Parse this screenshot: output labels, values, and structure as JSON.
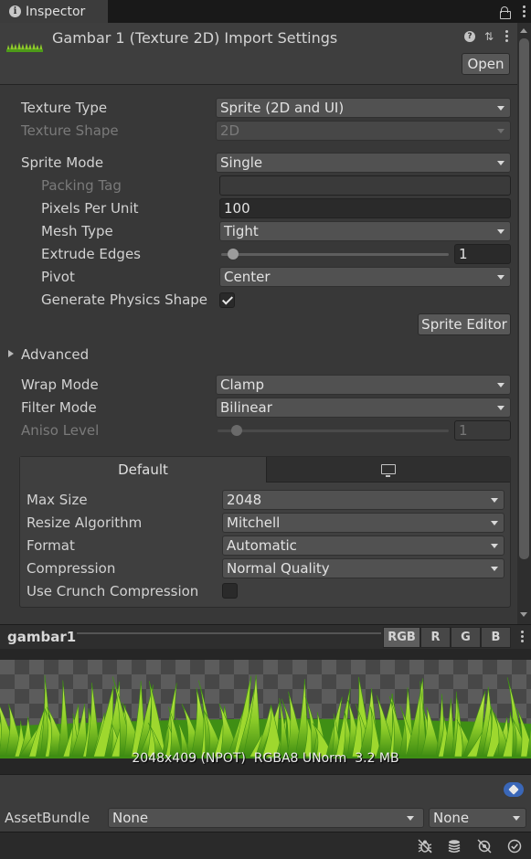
{
  "tab": {
    "title": "Inspector"
  },
  "header": {
    "title": "Gambar 1 (Texture 2D) Import Settings",
    "open_label": "Open"
  },
  "texture": {
    "texture_type": {
      "label": "Texture Type",
      "value": "Sprite (2D and UI)"
    },
    "texture_shape": {
      "label": "Texture Shape",
      "value": "2D"
    },
    "sprite_mode": {
      "label": "Sprite Mode",
      "value": "Single"
    },
    "packing_tag": {
      "label": "Packing Tag",
      "value": ""
    },
    "pixels_per_unit": {
      "label": "Pixels Per Unit",
      "value": "100"
    },
    "mesh_type": {
      "label": "Mesh Type",
      "value": "Tight"
    },
    "extrude_edges": {
      "label": "Extrude Edges",
      "value": "1",
      "slider_fraction": 0.03
    },
    "pivot": {
      "label": "Pivot",
      "value": "Center"
    },
    "generate_physics_shape": {
      "label": "Generate Physics Shape",
      "checked": true
    },
    "sprite_editor_label": "Sprite Editor",
    "advanced_label": "Advanced",
    "wrap_mode": {
      "label": "Wrap Mode",
      "value": "Clamp"
    },
    "filter_mode": {
      "label": "Filter Mode",
      "value": "Bilinear"
    },
    "aniso_level": {
      "label": "Aniso Level",
      "value": "1",
      "slider_fraction": 0.06
    }
  },
  "platform": {
    "tabs": {
      "default": "Default",
      "standalone_icon": "monitor-icon"
    },
    "max_size": {
      "label": "Max Size",
      "value": "2048"
    },
    "resize_algorithm": {
      "label": "Resize Algorithm",
      "value": "Mitchell"
    },
    "format": {
      "label": "Format",
      "value": "Automatic"
    },
    "compression": {
      "label": "Compression",
      "value": "Normal Quality"
    },
    "use_crunch": {
      "label": "Use Crunch Compression",
      "checked": false
    }
  },
  "preview": {
    "title": "gambar1",
    "channels": [
      "RGB",
      "R",
      "G",
      "B"
    ],
    "info": "2048x409 (NPOT)  RGBA8 UNorm  3.2 MB"
  },
  "asset_bundle": {
    "label": "AssetBundle",
    "name": "None",
    "variant": "None"
  },
  "colors": {
    "grass_light": "#9ed82e",
    "grass_dark": "#3f8f14",
    "tag_blue": "#3a67b8"
  }
}
